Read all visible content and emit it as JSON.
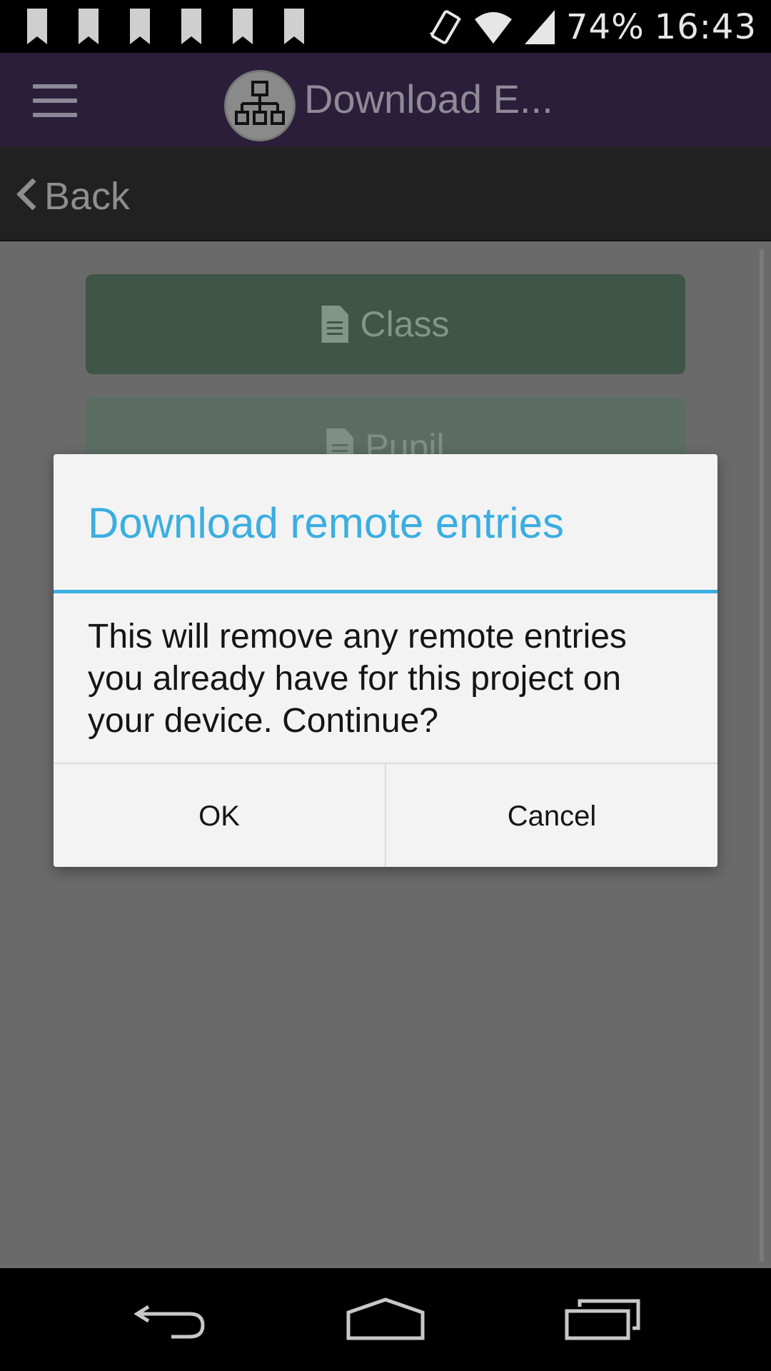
{
  "status_bar": {
    "battery": "74%",
    "time": "16:43",
    "notification_icons": [
      "bookmark-icon",
      "bookmark-icon",
      "bookmark-icon",
      "bookmark-icon",
      "bookmark-icon",
      "bookmark-icon"
    ]
  },
  "action_bar": {
    "title": "Download E...",
    "menu_icon": "hamburger-icon",
    "logo_icon": "network-icon"
  },
  "back_bar": {
    "label": "Back"
  },
  "content": {
    "buttons": [
      {
        "label": "Class",
        "icon": "document-icon"
      },
      {
        "label": "Pupil",
        "icon": "document-icon"
      }
    ]
  },
  "dialog": {
    "title": "Download remote entries",
    "message": "This will remove any remote entries you already have for this project on your device. Continue?",
    "ok_label": "OK",
    "cancel_label": "Cancel"
  },
  "nav_bar": {
    "back_icon": "nav-back-icon",
    "home_icon": "nav-home-icon",
    "recents_icon": "nav-recents-icon"
  },
  "colors": {
    "action_bar": "#2b1e3a",
    "dialog_accent": "#3aaee0",
    "class_button": "#3e5548",
    "pupil_button": "#5b6d63"
  }
}
